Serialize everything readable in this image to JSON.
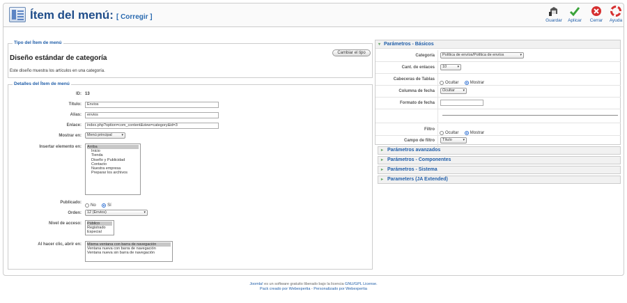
{
  "header": {
    "title": "Ítem del menú:",
    "subtitle": "[ Corregir ]",
    "toolbar": {
      "save": "Guardar",
      "apply": "Aplicar",
      "cancel": "Cerrar",
      "help": "Ayuda"
    }
  },
  "item_type": {
    "legend": "Tipo del Ítem de menú",
    "heading": "Diseño estándar de categoría",
    "description": "Este diseño muestra los artículos en una categoría.",
    "change_button": "Cambiar el tipo"
  },
  "details": {
    "legend": "Detalles del Ítem de menú",
    "id_label": "ID:",
    "id_value": "13",
    "title_label": "Título:",
    "title_value": "Envios",
    "alias_label": "Alias:",
    "alias_value": "envios",
    "link_label": "Enlace:",
    "link_value": "index.php?option=com_content&view=category&id=3",
    "show_in_label": "Mostrar en:",
    "show_in_value": "Menú principal",
    "insert_label": "Insertar elemento en:",
    "insert_options": [
      "Arriba",
      "Inicio",
      "Tienda",
      "Diseño y Publicidad",
      "Contacto",
      "Nuestra empresa",
      "Preparar los archivos"
    ],
    "published_label": "Publicado:",
    "published_no": "No",
    "published_yes": "Sí",
    "order_label": "Orden:",
    "order_value": "12 (Envios)",
    "access_label": "Nivel de acceso:",
    "access_options": [
      "Público",
      "Registrado",
      "Especial"
    ],
    "open_label": "Al hacer clic, abrir en:",
    "open_options": [
      "Misma ventana con barra de navegación",
      "Ventana nueva con barra de navegación",
      "Ventana nueva sin barra de navegación"
    ]
  },
  "params_basic": {
    "title": "Parámetros - Básicos",
    "category_label": "Categoría",
    "category_value": "Política de envíos/Política de envíos",
    "links_label": "Cant. de enlaces",
    "links_value": "10",
    "table_headers_label": "Cabeceras de Tablas",
    "hide": "Ocultar",
    "show": "Mostrar",
    "date_column_label": "Columna de fecha",
    "date_column_value": "Ocultar",
    "date_format_label": "Formato de fecha",
    "date_format_value": "",
    "filter_label": "Filtro",
    "filter_field_label": "Campo de filtro",
    "filter_field_value": "Título"
  },
  "accordions": [
    "Parámetros avanzados",
    "Parámetros - Componentes",
    "Parámetros - Sistema",
    "Parameters (JA Extended)"
  ],
  "footer": {
    "brand": "Joomla!",
    "text1": " es un software gratuito liberado bajo la licencia ",
    "license": "GNU/GPL License.",
    "line2_a": "Pack creado por Webexpertia",
    "sep": " - ",
    "line2_b": "Personalizado por Webexpertia"
  }
}
